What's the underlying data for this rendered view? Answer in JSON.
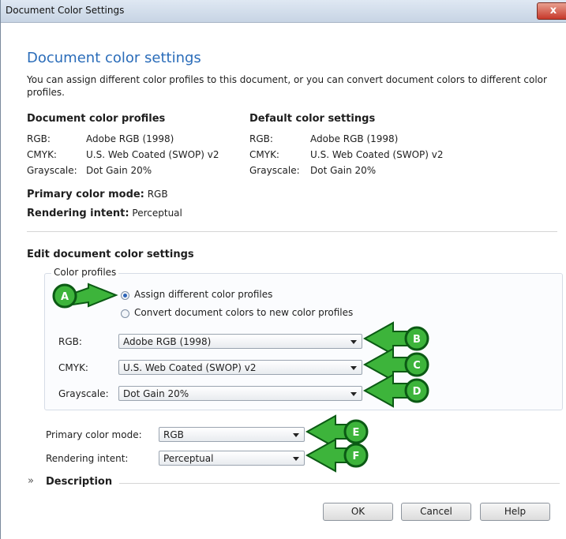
{
  "window": {
    "title": "Document Color Settings",
    "close_label": "x"
  },
  "heading": "Document color settings",
  "description_lines": [
    "You can assign different color profiles to this document, or you can convert document colors to different color",
    "profiles."
  ],
  "doc_profiles": {
    "title": "Document color profiles",
    "rows": [
      {
        "label": "RGB:",
        "value": "Adobe RGB (1998)"
      },
      {
        "label": "CMYK:",
        "value": "U.S. Web Coated (SWOP) v2"
      },
      {
        "label": "Grayscale:",
        "value": "Dot Gain 20%"
      }
    ]
  },
  "default_settings": {
    "title": "Default color settings",
    "rows": [
      {
        "label": "RGB:",
        "value": "Adobe RGB (1998)"
      },
      {
        "label": "CMYK:",
        "value": "U.S. Web Coated (SWOP) v2"
      },
      {
        "label": "Grayscale:",
        "value": "Dot Gain 20%"
      }
    ]
  },
  "primary_mode": {
    "label": "Primary color mode:",
    "value": "RGB"
  },
  "rendering": {
    "label": "Rendering intent:",
    "value": "Perceptual"
  },
  "edit": {
    "title": "Edit document color settings",
    "group_label": "Color profiles",
    "radio_assign": "Assign different color profiles",
    "radio_convert": "Convert document colors to new color profiles",
    "rgb_label": "RGB:",
    "rgb_value": "Adobe RGB (1998)",
    "cmyk_label": "CMYK:",
    "cmyk_value": "U.S. Web Coated (SWOP) v2",
    "gray_label": "Grayscale:",
    "gray_value": "Dot Gain 20%",
    "primary_label": "Primary color mode:",
    "primary_value": "RGB",
    "rendering_label": "Rendering intent:",
    "rendering_value": "Perceptual"
  },
  "description_toggle": "Description",
  "buttons": {
    "ok": "OK",
    "cancel": "Cancel",
    "help": "Help"
  },
  "callouts": [
    "A",
    "B",
    "C",
    "D",
    "E",
    "F"
  ],
  "colors": {
    "accent": "#2a6cb9",
    "callout_fill": "#3db43b",
    "callout_dark": "#0b5a14"
  }
}
